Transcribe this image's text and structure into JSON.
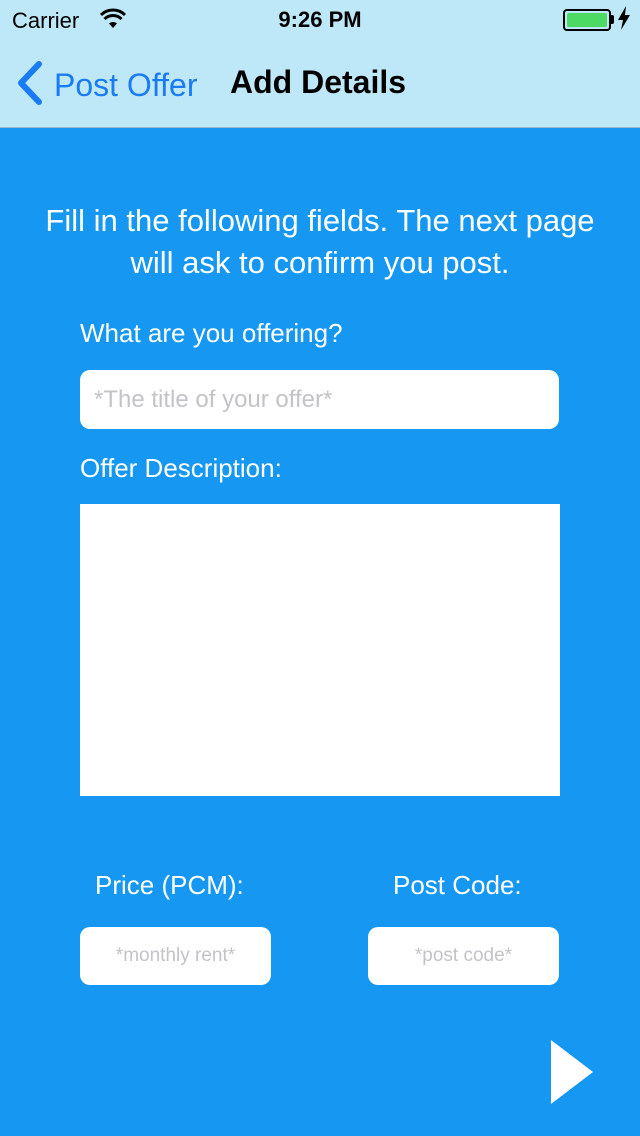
{
  "status_bar": {
    "carrier": "Carrier",
    "time": "9:26 PM"
  },
  "nav": {
    "back_label": "Post Offer",
    "title": "Add Details"
  },
  "form": {
    "instructions": "Fill in the following fields. The next page will ask to confirm you post.",
    "offering_label": "What are you offering?",
    "title_placeholder": "*The title of your offer*",
    "description_label": "Offer Description:",
    "description_value": "",
    "price_label": "Price (PCM):",
    "price_placeholder": "*monthly rent*",
    "postcode_label": "Post Code:",
    "postcode_placeholder": "*post code*"
  },
  "icons": {
    "back": "chevron-left-icon",
    "next": "play-triangle-icon",
    "wifi": "wifi-icon",
    "battery": "battery-icon",
    "charging": "bolt-icon"
  },
  "colors": {
    "background": "#1597f2",
    "nav_bar": "#bee8f7",
    "accent": "#1a7cf5",
    "battery": "#4cd964"
  }
}
